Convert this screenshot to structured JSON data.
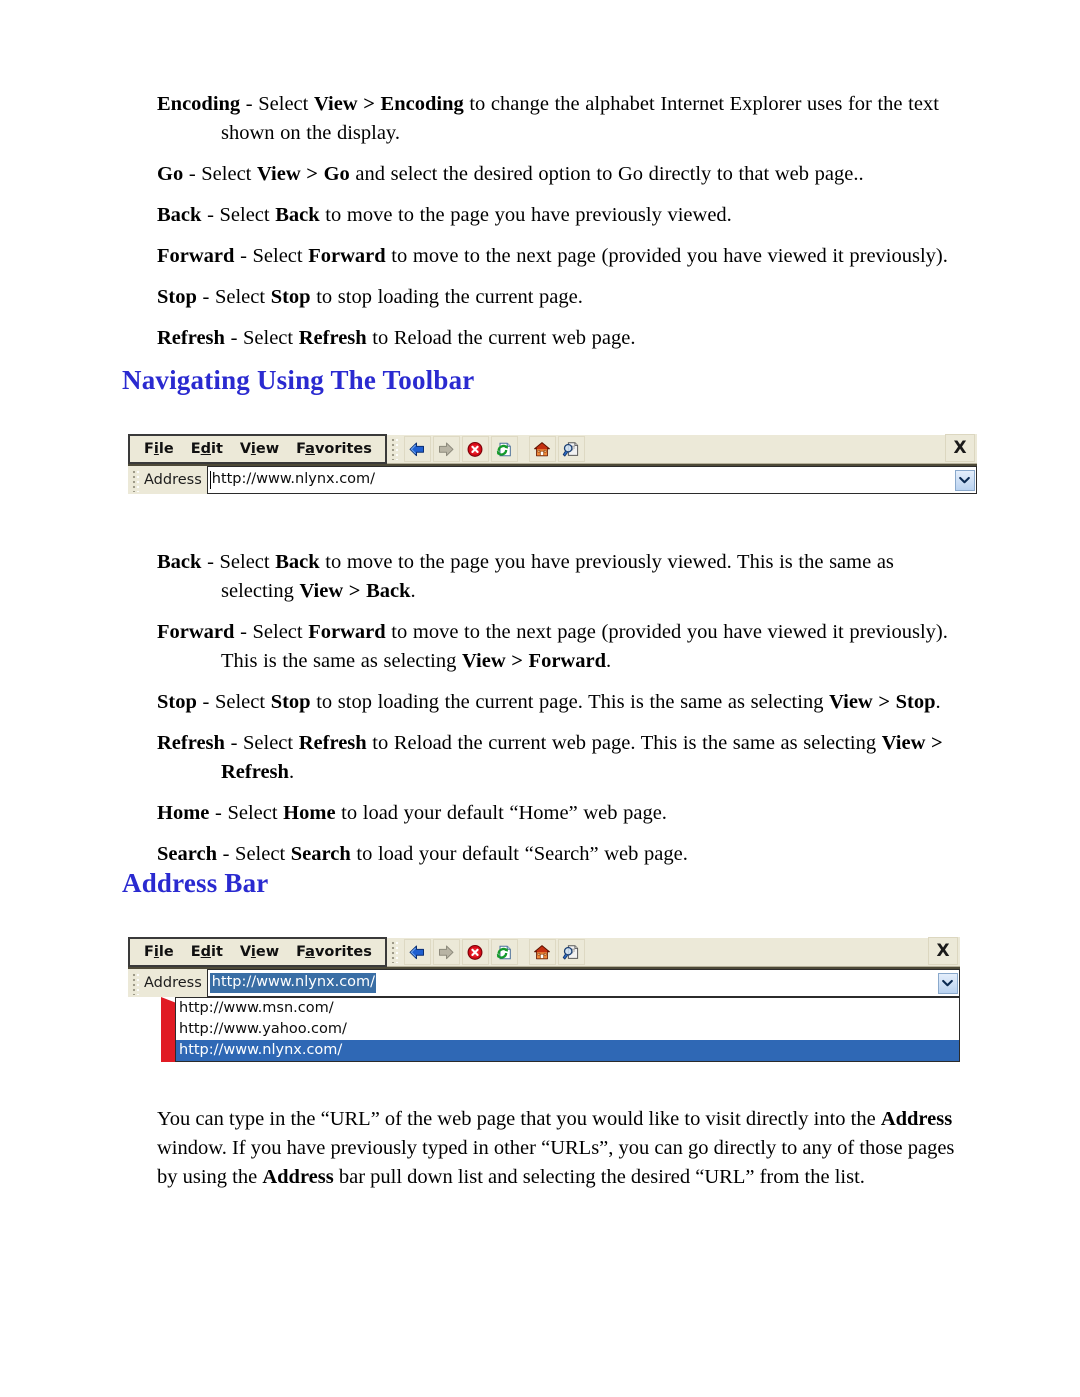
{
  "document": {
    "title": "Internet Explorer Navigation Help Page"
  },
  "top_section": {
    "items": [
      {
        "id": "encoding",
        "runs": [
          {
            "t": "Encoding",
            "b": true
          },
          {
            "t": " - Select ",
            "b": false
          },
          {
            "t": "View > Encoding",
            "b": true
          },
          {
            "t": " to change the alphabet Internet Explorer uses for the text shown on the display.",
            "b": false
          }
        ]
      },
      {
        "id": "go",
        "runs": [
          {
            "t": "Go",
            "b": true
          },
          {
            "t": " - Select ",
            "b": false
          },
          {
            "t": "View > Go",
            "b": true
          },
          {
            "t": " and select the desired option to Go directly to that web page..",
            "b": false
          }
        ]
      },
      {
        "id": "back",
        "runs": [
          {
            "t": "Back",
            "b": true
          },
          {
            "t": " - Select ",
            "b": false
          },
          {
            "t": "Back",
            "b": true
          },
          {
            "t": " to move to the page you have previously viewed.",
            "b": false
          }
        ]
      },
      {
        "id": "forward",
        "runs": [
          {
            "t": "Forward",
            "b": true
          },
          {
            "t": " - Select ",
            "b": false
          },
          {
            "t": "Forward",
            "b": true
          },
          {
            "t": " to move to the next page (provided you have viewed it previously).",
            "b": false
          }
        ]
      },
      {
        "id": "stop",
        "runs": [
          {
            "t": "Stop",
            "b": true
          },
          {
            "t": " - Select ",
            "b": false
          },
          {
            "t": "Stop",
            "b": true
          },
          {
            "t": " to stop loading the current page.",
            "b": false
          }
        ]
      },
      {
        "id": "refresh",
        "runs": [
          {
            "t": "Refresh",
            "b": true
          },
          {
            "t": " - Select ",
            "b": false
          },
          {
            "t": "Refresh",
            "b": true
          },
          {
            "t": " to Reload the current web page.",
            "b": false
          }
        ]
      }
    ]
  },
  "heading_toolbar": {
    "text": "Navigating Using The Toolbar",
    "color": "#2a2ad0"
  },
  "heading_address": {
    "text": "Address Bar",
    "color": "#2a2ad0"
  },
  "toolbar_figure": {
    "menu": [
      {
        "name": "file",
        "pre": "F",
        "accel": "i",
        "post": "le"
      },
      {
        "name": "edit",
        "pre": "E",
        "accel": "d",
        "post": "it"
      },
      {
        "name": "view",
        "pre": "V",
        "accel": "i",
        "post": "ew"
      },
      {
        "name": "favorites",
        "pre": "F",
        "accel": "a",
        "post": "vorites"
      }
    ],
    "buttons": [
      {
        "name": "back-button",
        "icon": "back-arrow-icon",
        "state": "enabled"
      },
      {
        "name": "forward-button",
        "icon": "forward-arrow-icon",
        "state": "disabled"
      },
      {
        "name": "stop-button",
        "icon": "stop-icon",
        "state": "enabled"
      },
      {
        "name": "refresh-button",
        "icon": "refresh-icon",
        "state": "enabled"
      },
      {
        "name": "home-button",
        "icon": "home-icon",
        "state": "enabled"
      },
      {
        "name": "search-button",
        "icon": "search-page-icon",
        "state": "enabled"
      }
    ],
    "close_label": "X",
    "address_label": "Address",
    "address_value": "http://www.nlynx.com/",
    "dropdown_icon": "chevron-down-icon"
  },
  "addressbar_figure": {
    "menu": [
      {
        "name": "file",
        "pre": "F",
        "accel": "i",
        "post": "le"
      },
      {
        "name": "edit",
        "pre": "E",
        "accel": "d",
        "post": "it"
      },
      {
        "name": "view",
        "pre": "V",
        "accel": "i",
        "post": "ew"
      },
      {
        "name": "favorites",
        "pre": "F",
        "accel": "a",
        "post": "vorites"
      }
    ],
    "buttons": [
      {
        "name": "back-button",
        "icon": "back-arrow-icon",
        "state": "enabled"
      },
      {
        "name": "forward-button",
        "icon": "forward-arrow-icon",
        "state": "disabled"
      },
      {
        "name": "stop-button",
        "icon": "stop-icon",
        "state": "enabled"
      },
      {
        "name": "refresh-button",
        "icon": "refresh-icon",
        "state": "enabled"
      },
      {
        "name": "home-button",
        "icon": "home-icon",
        "state": "enabled"
      },
      {
        "name": "search-button",
        "icon": "search-page-icon",
        "state": "enabled"
      }
    ],
    "close_label": "X",
    "address_label": "Address",
    "address_value": "http://www.nlynx.com/",
    "address_value_selected": true,
    "dropdown_icon": "chevron-down-icon",
    "history_items": [
      {
        "url": "http://www.msn.com/",
        "selected": false
      },
      {
        "url": "http://www.yahoo.com/",
        "selected": false
      },
      {
        "url": "http://www.nlynx.com/",
        "selected": true
      }
    ],
    "highlight_color": "#2f68b5"
  },
  "middle_section": {
    "items": [
      {
        "id": "back",
        "runs": [
          {
            "t": "Back",
            "b": true
          },
          {
            "t": " - Select ",
            "b": false
          },
          {
            "t": "Back",
            "b": true
          },
          {
            "t": " to move to the page you have previously viewed.  This is the same as selecting ",
            "b": false
          },
          {
            "t": "View > Back",
            "b": true
          },
          {
            "t": ".",
            "b": false
          }
        ]
      },
      {
        "id": "forward",
        "runs": [
          {
            "t": "Forward",
            "b": true
          },
          {
            "t": " - Select ",
            "b": false
          },
          {
            "t": "Forward",
            "b": true
          },
          {
            "t": " to move to the next page (provided you have viewed it previously).  This is the same as selecting ",
            "b": false
          },
          {
            "t": "View > Forward",
            "b": true
          },
          {
            "t": ".",
            "b": false
          }
        ]
      },
      {
        "id": "stop",
        "runs": [
          {
            "t": "Stop",
            "b": true
          },
          {
            "t": " - Select ",
            "b": false
          },
          {
            "t": "Stop",
            "b": true
          },
          {
            "t": " to stop loading the current page.  This is the same as selecting ",
            "b": false
          },
          {
            "t": "View > Stop",
            "b": true
          },
          {
            "t": ".",
            "b": false
          }
        ]
      },
      {
        "id": "refresh",
        "runs": [
          {
            "t": "Refresh",
            "b": true
          },
          {
            "t": " - Select ",
            "b": false
          },
          {
            "t": "Refresh",
            "b": true
          },
          {
            "t": " to Reload the current web page.  This is the same as selecting ",
            "b": false
          },
          {
            "t": "View > Refresh",
            "b": true
          },
          {
            "t": ".",
            "b": false
          }
        ]
      },
      {
        "id": "home",
        "runs": [
          {
            "t": "Home",
            "b": true
          },
          {
            "t": " - Select ",
            "b": false
          },
          {
            "t": "Home",
            "b": true
          },
          {
            "t": " to load your default “Home” web page.",
            "b": false
          }
        ]
      },
      {
        "id": "search",
        "runs": [
          {
            "t": "Search",
            "b": true
          },
          {
            "t": " - Select ",
            "b": false
          },
          {
            "t": "Search",
            "b": true
          },
          {
            "t": " to load your default “Search” web page.",
            "b": false
          }
        ]
      }
    ]
  },
  "bottom_section": {
    "paragraph_runs": [
      {
        "t": "You can type in the “URL” of the web page that you would like to visit directly into the ",
        "b": false
      },
      {
        "t": "Address",
        "b": true
      },
      {
        "t": " window.  If you have previously typed in other “URLs”, you can go directly to any of those pages by using the ",
        "b": false
      },
      {
        "t": "Address",
        "b": true
      },
      {
        "t": " bar pull down list and selecting the desired “URL” from the list.",
        "b": false
      }
    ]
  }
}
